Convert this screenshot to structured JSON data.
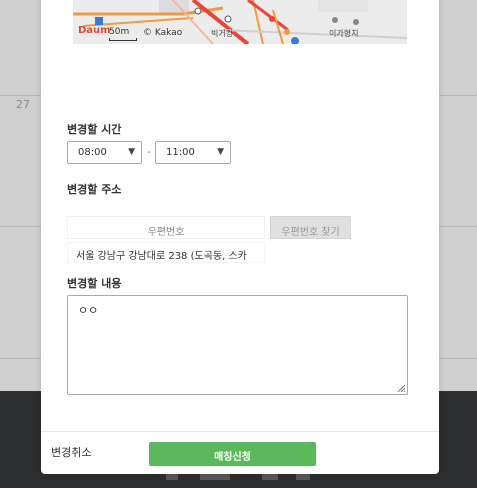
{
  "background": {
    "calendar_day": "27"
  },
  "map": {
    "logo": "Daum",
    "scale": "50m",
    "copyright": "© Kakao",
    "labels": [
      "빅거킹",
      "이가형치"
    ]
  },
  "form": {
    "time": {
      "label": "변경할 시간",
      "start": "08:00",
      "separator": "-",
      "end": "11:00"
    },
    "address": {
      "label": "변경할 주소",
      "postal_placeholder": "우편번호",
      "postal_button": "우편번호 찾기",
      "address_value": "서울 강남구 강남대로 238 (도곡동, 스카"
    },
    "content": {
      "label": "변경할 내용",
      "value": "ㅇㅇ"
    }
  },
  "footer": {
    "cancel_label": "변경취소",
    "submit_label": "매칭신청"
  },
  "colors": {
    "submit_green": "#5cb85c",
    "map_road_red": "#e8463c",
    "map_road_orange": "#f19a3e",
    "footer_dark": "#2b2d2f"
  },
  "icons": {
    "select_caret": "▼"
  }
}
